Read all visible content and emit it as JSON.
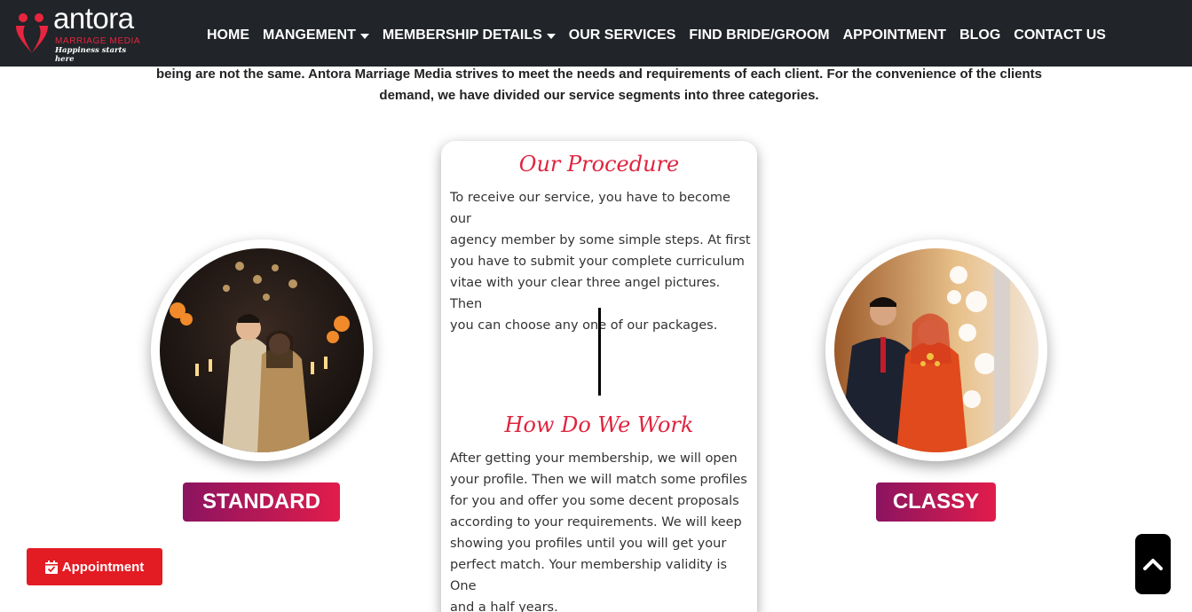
{
  "brand": {
    "name": "antora",
    "subtitle": "MARRIAGE MEDIA",
    "tagline": "Happiness starts here",
    "accent_color": "#e8253f"
  },
  "nav": {
    "items": [
      {
        "label": "HOME",
        "dropdown": false
      },
      {
        "label": "MANGEMENT",
        "dropdown": true
      },
      {
        "label": "MEMBERSHIP DETAILS",
        "dropdown": true
      },
      {
        "label": "OUR SERVICES",
        "dropdown": false
      },
      {
        "label": "FIND BRIDE/GROOM",
        "dropdown": false
      },
      {
        "label": "APPOINTMENT",
        "dropdown": false
      },
      {
        "label": "BLOG",
        "dropdown": false
      },
      {
        "label": "CONTACT US",
        "dropdown": false
      }
    ]
  },
  "intro": {
    "line1": "being are not the same. Antora Marriage Media strives to meet the needs and requirements of each client. For the convenience of the clients",
    "line2": "demand, we have divided our service segments into three categories."
  },
  "packages": {
    "standard": {
      "label": "STANDARD"
    },
    "classy": {
      "label": "CLASSY"
    }
  },
  "card": {
    "procedure_title": "Our Procedure",
    "procedure_lines": [
      "To receive our service, you have to become our",
      "agency member by some simple steps. At first",
      "you have to submit your complete curriculum",
      "vitae with your clear three angel pictures. Then",
      "you can choose any one of our packages."
    ],
    "work_title": "How Do We Work",
    "work_lines": [
      "After getting your membership, we will open",
      "your profile. Then we will match some profiles",
      "for you and offer you some decent proposals",
      "according to your requirements. We will keep",
      "showing you profiles until you will get your",
      "perfect match. Your membership validity is One",
      "and a half years."
    ]
  },
  "floating": {
    "appointment_label": "Appointment",
    "scroll_top_icon": "chevron-up-icon"
  },
  "colors": {
    "nav_bg": "#212428",
    "title_red": "#e0243f",
    "button_gradient_start": "#8b1460",
    "button_gradient_end": "#e21c4b",
    "appointment_red": "#e31b23"
  }
}
